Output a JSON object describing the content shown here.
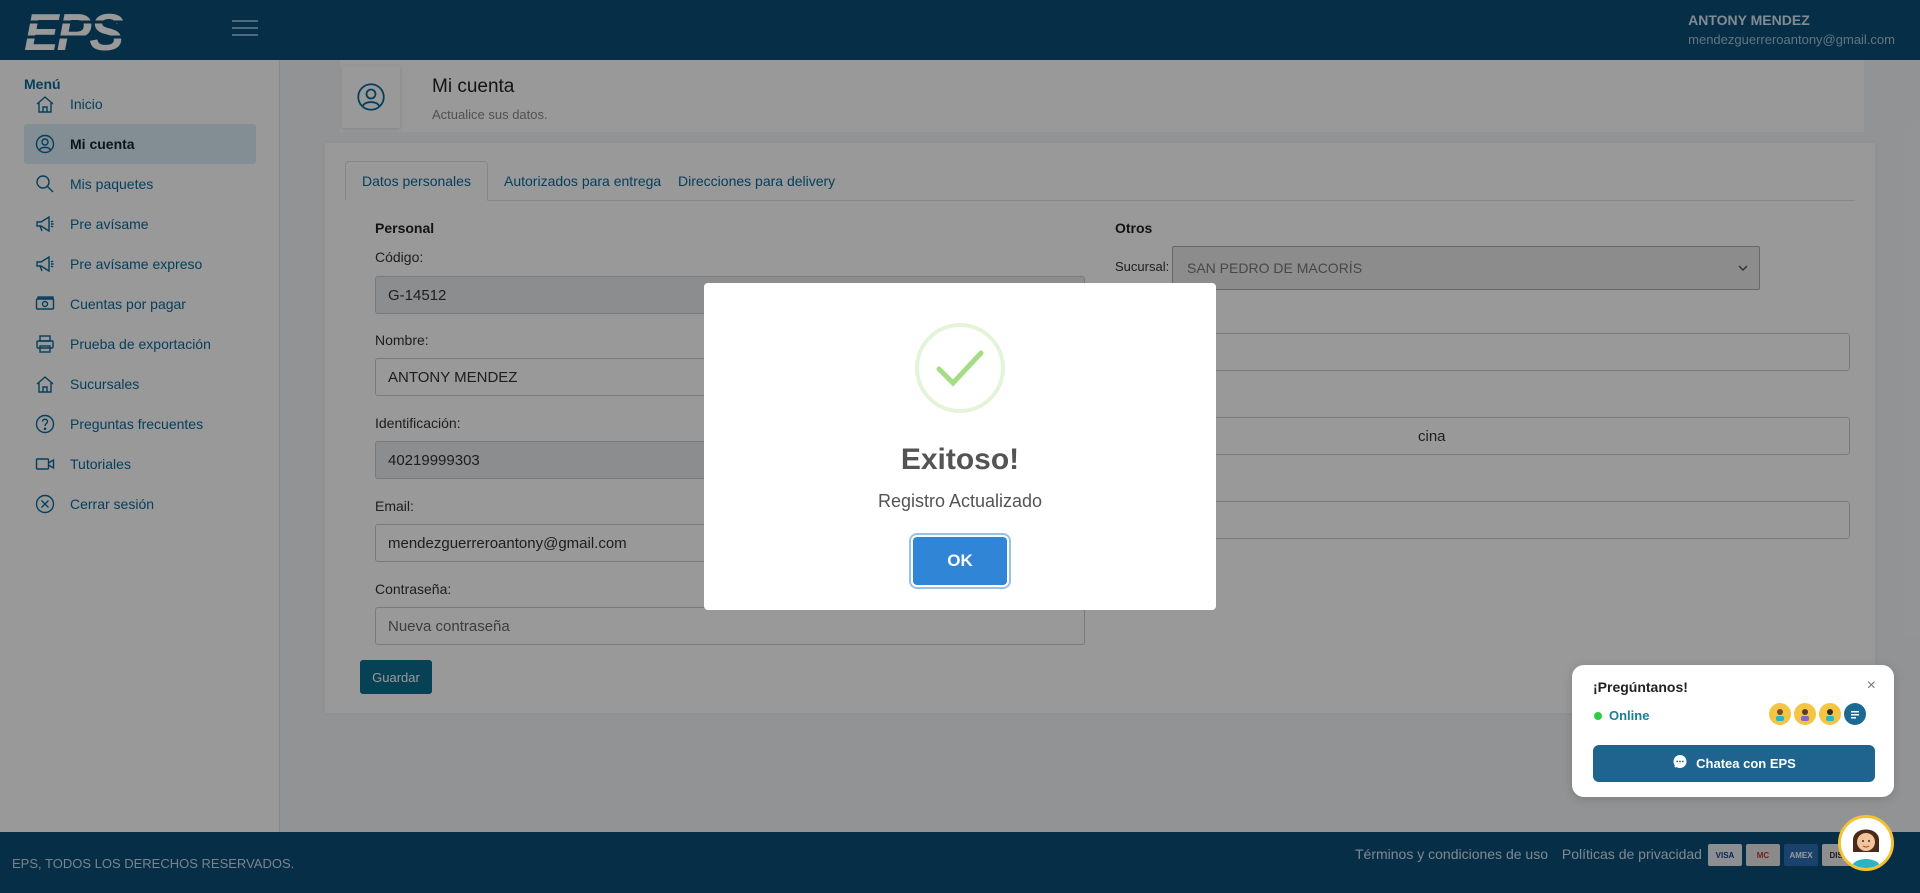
{
  "header": {
    "logo_text": "EPS",
    "user_name": "ANTONY MENDEZ",
    "user_email": "mendezguerreroantony@gmail.com"
  },
  "sidebar": {
    "title": "Menú",
    "items": [
      {
        "label": "Inicio",
        "icon": "home-icon"
      },
      {
        "label": "Mi cuenta",
        "icon": "user-icon",
        "active": true
      },
      {
        "label": "Mis paquetes",
        "icon": "search-icon"
      },
      {
        "label": "Pre avísame",
        "icon": "megaphone-icon"
      },
      {
        "label": "Pre avísame expreso",
        "icon": "megaphone-icon"
      },
      {
        "label": "Cuentas por pagar",
        "icon": "money-icon"
      },
      {
        "label": "Prueba de exportación",
        "icon": "printer-icon"
      },
      {
        "label": "Sucursales",
        "icon": "home-icon"
      },
      {
        "label": "Preguntas frecuentes",
        "icon": "question-icon"
      },
      {
        "label": "Tutoriales",
        "icon": "video-icon"
      },
      {
        "label": "Cerrar sesión",
        "icon": "close-circle-icon"
      }
    ]
  },
  "page": {
    "title": "Mi cuenta",
    "subtitle": "Actualice sus datos."
  },
  "tabs": [
    "Datos personales",
    "Autorizados para entrega",
    "Direcciones para delivery"
  ],
  "form": {
    "personal_title": "Personal",
    "codigo_label": "Código:",
    "codigo_value": "G-14512",
    "nombre_label": "Nombre:",
    "nombre_value": "ANTONY MENDEZ",
    "id_label": "Identificación:",
    "id_value": "40219999303",
    "email_label": "Email:",
    "email_value": "mendezguerreroantony@gmail.com",
    "password_label": "Contraseña:",
    "password_placeholder": "Nueva contraseña",
    "otros_title": "Otros",
    "sucursal_label": "Sucursal:",
    "sucursal_value": "SAN PEDRO DE MACORÍS",
    "partial_value": "cina",
    "save_label": "Guardar"
  },
  "modal": {
    "title": "Exitoso!",
    "text": "Registro Actualizado",
    "ok_label": "OK"
  },
  "chat": {
    "title": "¡Pregúntanos!",
    "status": "Online",
    "button_label": "Chatea con EPS",
    "close": "×"
  },
  "footer": {
    "copyright": "EPS, TODOS LOS DERECHOS RESERVADOS.",
    "terms": "Términos y condiciones de uso",
    "privacy": "Políticas de privacidad",
    "cards": [
      "VISA",
      "MC",
      "AMEX",
      "DISC"
    ]
  },
  "colors": {
    "header": "#0a4d76",
    "accent": "#0b6a9a",
    "ok_button": "#3085d6",
    "success": "#a5dc86"
  }
}
